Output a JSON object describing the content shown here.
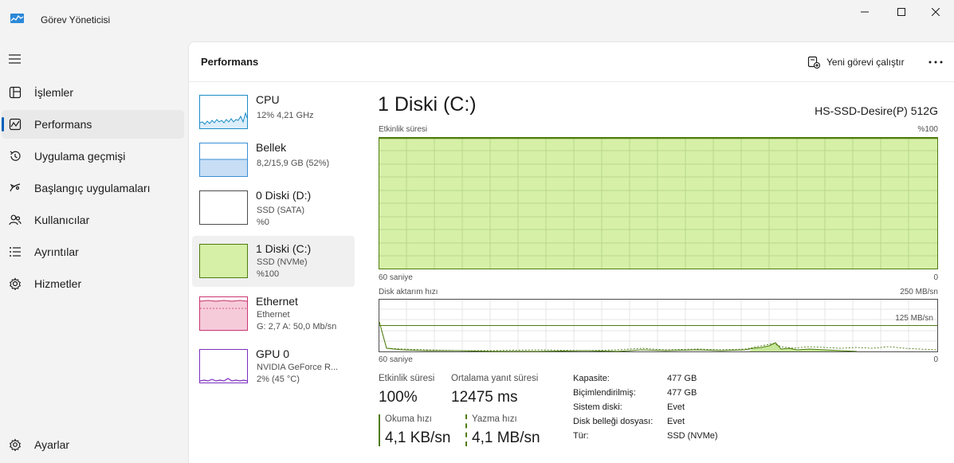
{
  "window": {
    "title": "Görev Yöneticisi"
  },
  "sidebar": {
    "items": [
      {
        "label": "İşlemler",
        "icon": "processes-icon"
      },
      {
        "label": "Performans",
        "icon": "performance-icon"
      },
      {
        "label": "Uygulama geçmişi",
        "icon": "history-icon"
      },
      {
        "label": "Başlangıç uygulamaları",
        "icon": "startup-icon"
      },
      {
        "label": "Kullanıcılar",
        "icon": "users-icon"
      },
      {
        "label": "Ayrıntılar",
        "icon": "details-icon"
      },
      {
        "label": "Hizmetler",
        "icon": "services-icon"
      }
    ],
    "settings_label": "Ayarlar"
  },
  "header": {
    "title": "Performans",
    "new_task_label": "Yeni görevi çalıştır"
  },
  "devices": [
    {
      "name": "CPU",
      "lines": [
        "12%  4,21 GHz"
      ],
      "color": "#1c8dc7"
    },
    {
      "name": "Bellek",
      "lines": [
        "8,2/15,9 GB (52%)"
      ],
      "color": "#3a8fd6"
    },
    {
      "name": "0 Diski (D:)",
      "lines": [
        "SSD (SATA)",
        "%0"
      ],
      "color": "#4d7c0f"
    },
    {
      "name": "1 Diski (C:)",
      "lines": [
        "SSD (NVMe)",
        "%100"
      ],
      "color": "#4d7c0f"
    },
    {
      "name": "Ethernet",
      "lines": [
        "Ethernet",
        "G: 2,7  A: 50,0 Mb/sn"
      ],
      "color": "#c9356e"
    },
    {
      "name": "GPU 0",
      "lines": [
        "NVIDIA GeForce R...",
        "2%  (45 °C)"
      ],
      "color": "#7b2fbf"
    }
  ],
  "detail": {
    "title": "1 Diski (C:)",
    "model": "HS-SSD-Desire(P) 512G",
    "activity_graph": {
      "label": "Etkinlik süresi",
      "max_label": "%100",
      "left_label": "60 saniye",
      "right_label": "0",
      "level_percent": 100
    },
    "transfer_graph": {
      "label": "Disk aktarım hızı",
      "max_label": "250 MB/sn",
      "mid_label": "125 MB/sn",
      "left_label": "60 saniye",
      "right_label": "0"
    },
    "stats": {
      "activity_label": "Etkinlik süresi",
      "activity_value": "100%",
      "response_label": "Ortalama yanıt süresi",
      "response_value": "12475 ms",
      "read_label": "Okuma hızı",
      "read_value": "4,1 KB/sn",
      "write_label": "Yazma hızı",
      "write_value": "4,1 MB/sn"
    },
    "properties": [
      {
        "key": "Kapasite:",
        "value": "477 GB"
      },
      {
        "key": "Biçimlendirilmiş:",
        "value": "477 GB"
      },
      {
        "key": "Sistem diski:",
        "value": "Evet"
      },
      {
        "key": "Disk belleği dosyası:",
        "value": "Evet"
      },
      {
        "key": "Tür:",
        "value": "SSD (NVMe)"
      }
    ]
  },
  "colors": {
    "accent": "#005fb8",
    "disk_fill": "#d6f0a8",
    "disk_line": "#4d7c0f"
  }
}
